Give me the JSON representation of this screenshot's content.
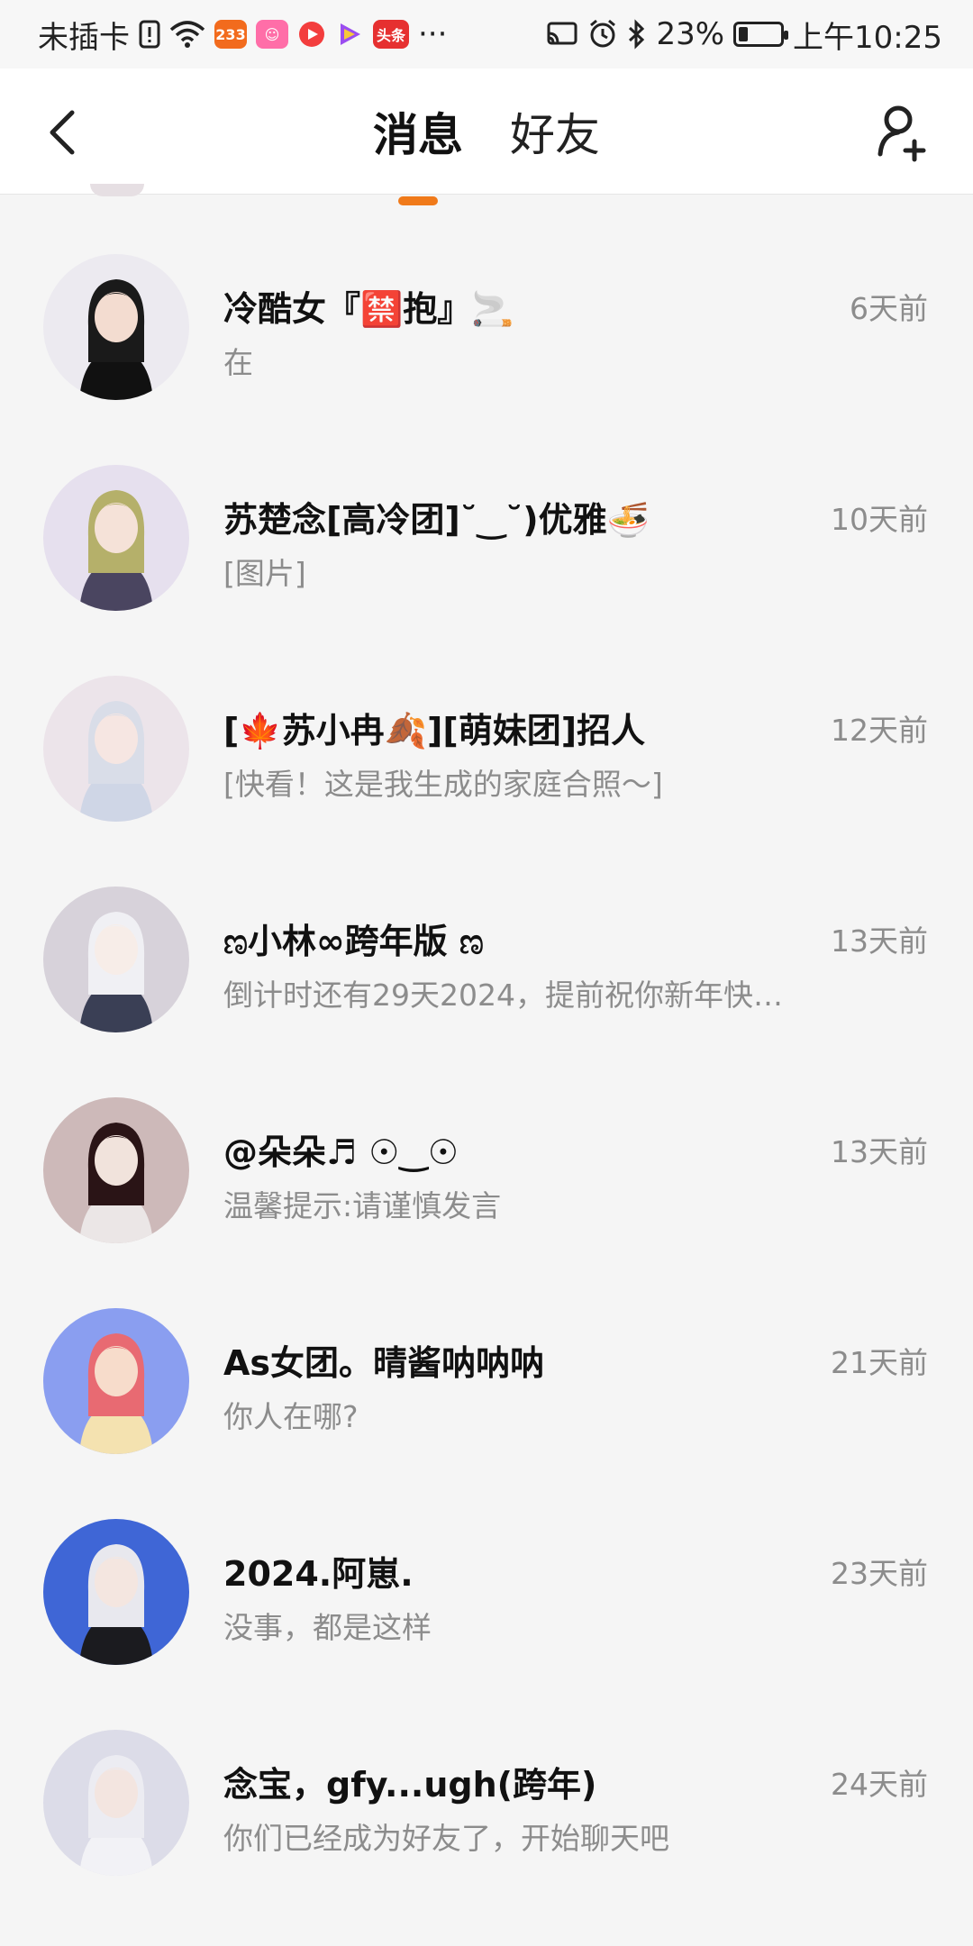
{
  "status_bar": {
    "carrier": "未插卡",
    "app_badge_233": "233",
    "app_badge_news": "头条",
    "more": "···",
    "battery_text": "23%",
    "battery_level": 0.23,
    "time": "上午10:25"
  },
  "header": {
    "tab_messages": "消息",
    "tab_friends": "好友",
    "accent_color": "#f07a1a"
  },
  "chats": [
    {
      "name": "冷酷女『🈲抱』🚬",
      "message": "在",
      "time": "6天前"
    },
    {
      "name": "苏楚念[高冷团]˘‿˘)优雅🍜",
      "message": "[图片]",
      "time": "10天前"
    },
    {
      "name": "[🍁苏小冉🍂][萌妹团]招人",
      "message": "[快看！这是我生成的家庭合照～]",
      "time": "12天前"
    },
    {
      "name": "ಣ小林∞跨年版 ಣ",
      "message": "倒计时还有29天2024，提前祝你新年快…",
      "time": "13天前"
    },
    {
      "name": "@朵朵♬ ☉‿☉",
      "message": "温馨提示:请谨慎发言",
      "time": "13天前"
    },
    {
      "name": "As女团。晴酱呐呐呐",
      "message": "你人在哪?",
      "time": "21天前"
    },
    {
      "name": "2024.阿崽.",
      "message": "没事，都是这样",
      "time": "23天前"
    },
    {
      "name": "念宝，gfy...ugh(跨年)",
      "message": "你们已经成为好友了，开始聊天吧",
      "time": "24天前"
    }
  ]
}
